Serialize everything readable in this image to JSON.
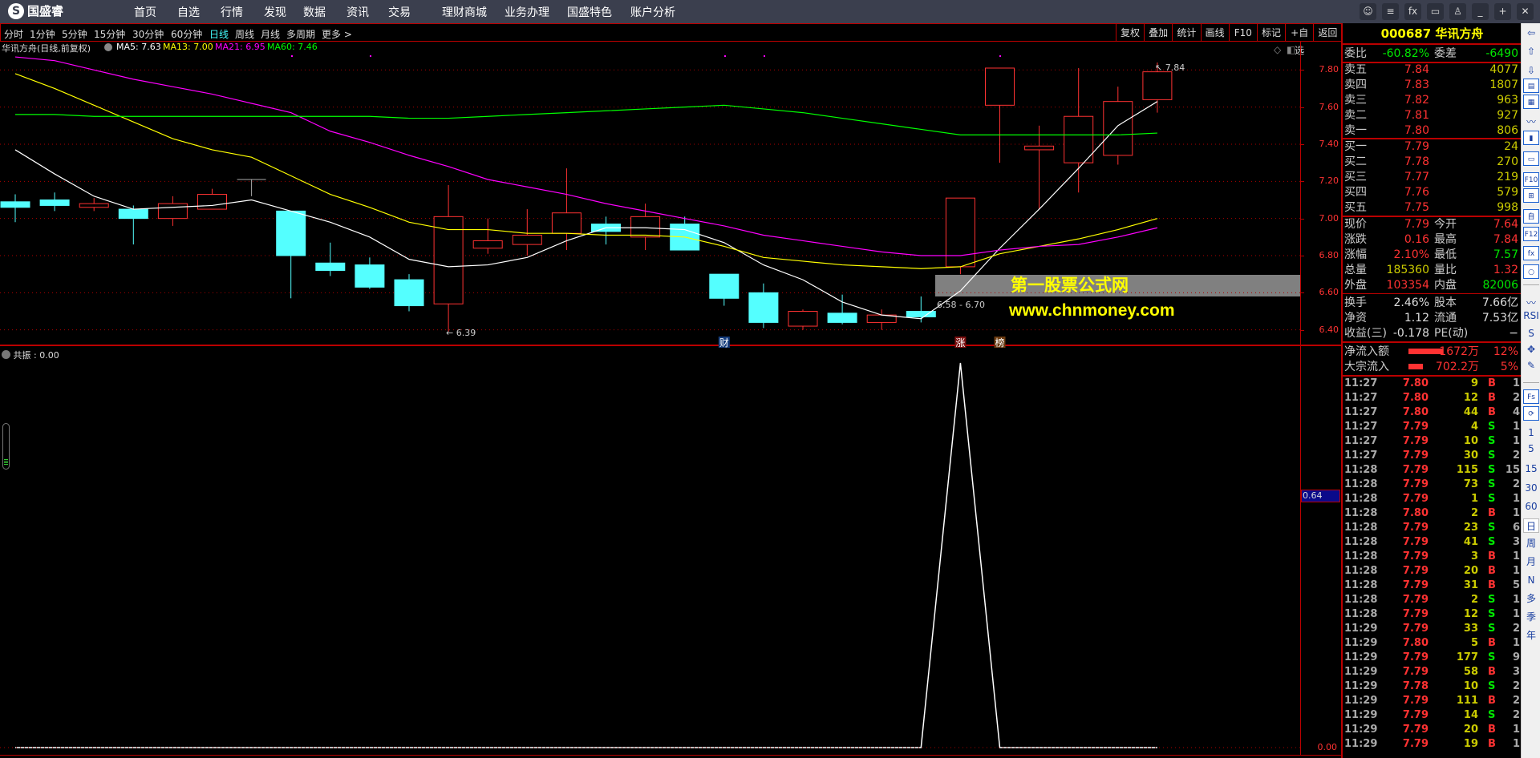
{
  "app": {
    "logo": "国盛睿",
    "nav": [
      "首页",
      "自选",
      "行情",
      "发现",
      "数据",
      "资讯",
      "交易",
      "理财商城",
      "业务办理",
      "国盛特色",
      "账户分析"
    ],
    "window_icons": [
      "chat-icon",
      "sliders-icon",
      "fx-icon",
      "monitor-icon",
      "shirt-icon",
      "minimize-icon",
      "restore-icon",
      "close-icon"
    ]
  },
  "toolbar": {
    "periods": [
      "分时",
      "1分钟",
      "5分钟",
      "15分钟",
      "30分钟",
      "60分钟",
      "日线",
      "周线",
      "月线",
      "多周期",
      "更多 >"
    ],
    "selected": "日线",
    "actions": [
      "复权",
      "叠加",
      "统计",
      "画线",
      "F10",
      "标记",
      "+自选",
      "返回"
    ]
  },
  "chart_header": {
    "title": "华讯方舟(日线,前复权)",
    "ma": [
      {
        "label": "MA5: 7.63",
        "color": "#ffffff"
      },
      {
        "label": "MA13: 7.00",
        "color": "#ffff00"
      },
      {
        "label": "MA21: 6.95",
        "color": "#ff00ff"
      },
      {
        "label": "MA60: 7.46",
        "color": "#00ff00"
      }
    ]
  },
  "chart_data": {
    "type": "candlestick",
    "ylim": [
      6.35,
      7.9
    ],
    "y_ticks": [
      "7.80",
      "7.60",
      "7.40",
      "7.20",
      "7.00",
      "6.80",
      "6.60",
      "6.40"
    ],
    "candles": [
      [
        7.09,
        7.13,
        6.98,
        7.06
      ],
      [
        7.1,
        7.14,
        7.04,
        7.07
      ],
      [
        7.06,
        7.11,
        7.04,
        7.08
      ],
      [
        7.05,
        7.07,
        6.86,
        7.0
      ],
      [
        7.0,
        7.12,
        6.96,
        7.08
      ],
      [
        7.05,
        7.16,
        7.05,
        7.13
      ],
      [
        7.21,
        7.21,
        7.12,
        7.21
      ],
      [
        7.04,
        7.04,
        6.57,
        6.8
      ],
      [
        6.76,
        6.87,
        6.69,
        6.72
      ],
      [
        6.75,
        6.79,
        6.62,
        6.63
      ],
      [
        6.67,
        6.7,
        6.5,
        6.53
      ],
      [
        6.54,
        7.18,
        6.39,
        7.01
      ],
      [
        6.84,
        7.0,
        6.81,
        6.88
      ],
      [
        6.86,
        7.05,
        6.8,
        6.91
      ],
      [
        6.92,
        7.27,
        6.83,
        7.03
      ],
      [
        6.97,
        7.01,
        6.86,
        6.93
      ],
      [
        6.9,
        7.08,
        6.83,
        7.01
      ],
      [
        6.97,
        7.01,
        6.83,
        6.83
      ],
      [
        6.7,
        6.7,
        6.53,
        6.57
      ],
      [
        6.6,
        6.65,
        6.41,
        6.44
      ],
      [
        6.42,
        6.51,
        6.4,
        6.5
      ],
      [
        6.49,
        6.59,
        6.43,
        6.44
      ],
      [
        6.44,
        6.51,
        6.4,
        6.48
      ],
      [
        6.5,
        6.58,
        6.44,
        6.47
      ],
      [
        6.74,
        7.11,
        6.7,
        7.11
      ],
      [
        7.61,
        7.81,
        7.3,
        7.81
      ],
      [
        7.37,
        7.5,
        7.05,
        7.39
      ],
      [
        7.3,
        7.81,
        7.14,
        7.55
      ],
      [
        7.34,
        7.71,
        7.29,
        7.63
      ],
      [
        7.64,
        7.84,
        7.57,
        7.79
      ]
    ],
    "series": [
      {
        "name": "MA5",
        "color": "#ffffff",
        "values": [
          7.37,
          7.24,
          7.12,
          7.05,
          7.06,
          7.07,
          7.1,
          7.04,
          6.98,
          6.9,
          6.78,
          6.74,
          6.75,
          6.79,
          6.88,
          6.95,
          6.95,
          6.94,
          6.87,
          6.75,
          6.67,
          6.55,
          6.48,
          6.46,
          6.61,
          6.84,
          7.05,
          7.27,
          7.5,
          7.63
        ]
      },
      {
        "name": "MA13",
        "color": "#ffff00",
        "values": [
          7.78,
          7.7,
          7.61,
          7.52,
          7.43,
          7.37,
          7.33,
          7.23,
          7.13,
          7.06,
          6.98,
          6.94,
          6.94,
          6.92,
          6.92,
          6.91,
          6.91,
          6.9,
          6.85,
          6.79,
          6.77,
          6.75,
          6.74,
          6.73,
          6.74,
          6.81,
          6.85,
          6.89,
          6.94,
          7.0
        ]
      },
      {
        "name": "MA21",
        "color": "#ff00ff",
        "values": [
          7.87,
          7.85,
          7.8,
          7.75,
          7.71,
          7.67,
          7.62,
          7.57,
          7.47,
          7.41,
          7.34,
          7.28,
          7.21,
          7.17,
          7.13,
          7.08,
          7.04,
          7.0,
          6.96,
          6.91,
          6.88,
          6.85,
          6.82,
          6.8,
          6.8,
          6.83,
          6.85,
          6.86,
          6.9,
          6.95
        ]
      },
      {
        "name": "MA60",
        "color": "#00ff00",
        "values": [
          7.56,
          7.56,
          7.55,
          7.55,
          7.55,
          7.55,
          7.55,
          7.55,
          7.55,
          7.55,
          7.54,
          7.54,
          7.55,
          7.56,
          7.57,
          7.58,
          7.59,
          7.6,
          7.61,
          7.59,
          7.57,
          7.54,
          7.51,
          7.48,
          7.45,
          7.45,
          7.45,
          7.45,
          7.45,
          7.46
        ]
      }
    ],
    "annotations": {
      "low": "6.39",
      "high": "7.84",
      "range": "6.58 - 6.70"
    },
    "event_marks": [
      {
        "index": 18,
        "text": "财"
      },
      {
        "index": 24,
        "text": "涨"
      },
      {
        "index": 25,
        "text": "榜"
      }
    ],
    "indicator": {
      "name": "共振",
      "value_label": "共振 : 0.00",
      "values": [
        0,
        0,
        0,
        0,
        0,
        0,
        0,
        0,
        0,
        0,
        0,
        0,
        0,
        0,
        0,
        0,
        0,
        0,
        0,
        0,
        0,
        0,
        0,
        0,
        1,
        0,
        0,
        0,
        0,
        0
      ],
      "axis_labels": [
        "0.64",
        "0.00"
      ]
    }
  },
  "watermark": {
    "title": "第一股票公式网",
    "url": "www.chnmoney.com"
  },
  "quote": {
    "code": "000687",
    "name": "华讯方舟",
    "weibi": {
      "label": "委比",
      "value": "-60.82%",
      "label2": "委差",
      "value2": "-6490"
    },
    "asks": [
      [
        "卖五",
        "7.84",
        "4077"
      ],
      [
        "卖四",
        "7.83",
        "1807"
      ],
      [
        "卖三",
        "7.82",
        "963"
      ],
      [
        "卖二",
        "7.81",
        "927"
      ],
      [
        "卖一",
        "7.80",
        "806"
      ]
    ],
    "bids": [
      [
        "买一",
        "7.79",
        "24"
      ],
      [
        "买二",
        "7.78",
        "270"
      ],
      [
        "买三",
        "7.77",
        "219"
      ],
      [
        "买四",
        "7.76",
        "579"
      ],
      [
        "买五",
        "7.75",
        "998"
      ]
    ],
    "stats": [
      [
        "现价",
        "7.79",
        "red",
        "今开",
        "7.64",
        "red"
      ],
      [
        "涨跌",
        "0.16",
        "red",
        "最高",
        "7.84",
        "red"
      ],
      [
        "涨幅",
        "2.10%",
        "red",
        "最低",
        "7.57",
        "grn"
      ],
      [
        "总量",
        "185360",
        "yel",
        "量比",
        "1.32",
        "red"
      ],
      [
        "外盘",
        "103354",
        "red",
        "内盘",
        "82006",
        "grn"
      ]
    ],
    "fund": [
      [
        "换手",
        "2.46%",
        "股本",
        "7.66亿"
      ],
      [
        "净资",
        "1.12",
        "流通",
        "7.53亿"
      ],
      [
        "收益(三)",
        "-0.178",
        "PE(动)",
        "−"
      ]
    ],
    "flows": [
      {
        "label": "净流入额",
        "value": "1672万",
        "pct": "12%",
        "bar": 0.12
      },
      {
        "label": "大宗流入",
        "value": "702.2万",
        "pct": "5%",
        "bar": 0.05
      }
    ]
  },
  "trades": [
    [
      "11:27",
      "7.80",
      "9",
      "B",
      "1"
    ],
    [
      "11:27",
      "7.80",
      "12",
      "B",
      "2"
    ],
    [
      "11:27",
      "7.80",
      "44",
      "B",
      "4"
    ],
    [
      "11:27",
      "7.79",
      "4",
      "S",
      "1"
    ],
    [
      "11:27",
      "7.79",
      "10",
      "S",
      "1"
    ],
    [
      "11:27",
      "7.79",
      "30",
      "S",
      "2"
    ],
    [
      "11:28",
      "7.79",
      "115",
      "S",
      "15"
    ],
    [
      "11:28",
      "7.79",
      "73",
      "S",
      "2"
    ],
    [
      "11:28",
      "7.79",
      "1",
      "S",
      "1"
    ],
    [
      "11:28",
      "7.80",
      "2",
      "B",
      "1"
    ],
    [
      "11:28",
      "7.79",
      "23",
      "S",
      "6"
    ],
    [
      "11:28",
      "7.79",
      "41",
      "S",
      "3"
    ],
    [
      "11:28",
      "7.79",
      "3",
      "B",
      "1"
    ],
    [
      "11:28",
      "7.79",
      "20",
      "B",
      "1"
    ],
    [
      "11:28",
      "7.79",
      "31",
      "B",
      "5"
    ],
    [
      "11:28",
      "7.79",
      "2",
      "S",
      "1"
    ],
    [
      "11:28",
      "7.79",
      "12",
      "S",
      "1"
    ],
    [
      "11:29",
      "7.79",
      "33",
      "S",
      "2"
    ],
    [
      "11:29",
      "7.80",
      "5",
      "B",
      "1"
    ],
    [
      "11:29",
      "7.79",
      "177",
      "S",
      "9"
    ],
    [
      "11:29",
      "7.79",
      "58",
      "B",
      "3"
    ],
    [
      "11:29",
      "7.78",
      "10",
      "S",
      "2"
    ],
    [
      "11:29",
      "7.79",
      "111",
      "B",
      "2"
    ],
    [
      "11:29",
      "7.79",
      "14",
      "S",
      "2"
    ],
    [
      "11:29",
      "7.79",
      "20",
      "B",
      "1"
    ],
    [
      "11:29",
      "7.79",
      "19",
      "B",
      "1"
    ]
  ],
  "sidebar": {
    "items": [
      "⇦",
      "⇧",
      "⇩",
      "▤",
      "▦",
      "〰",
      "▮",
      "▭",
      "F10",
      "⊞",
      "自",
      "F12",
      "fx",
      "○",
      "〰",
      "RSI",
      "S",
      "✥",
      "✎",
      "Fs",
      "⟳",
      "1",
      "5",
      "15",
      "30",
      "60",
      "日",
      "周",
      "月",
      "N",
      "多",
      "季",
      "年"
    ],
    "selected": "日"
  }
}
